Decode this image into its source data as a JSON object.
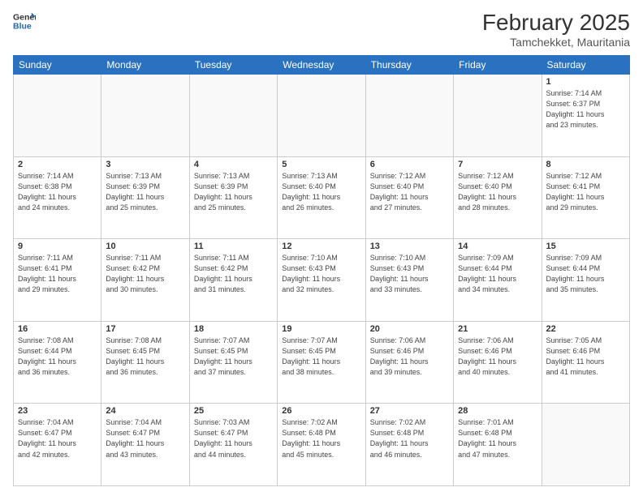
{
  "header": {
    "logo_line1": "General",
    "logo_line2": "Blue",
    "month": "February 2025",
    "location": "Tamchekket, Mauritania"
  },
  "weekdays": [
    "Sunday",
    "Monday",
    "Tuesday",
    "Wednesday",
    "Thursday",
    "Friday",
    "Saturday"
  ],
  "weeks": [
    [
      {
        "day": "",
        "info": ""
      },
      {
        "day": "",
        "info": ""
      },
      {
        "day": "",
        "info": ""
      },
      {
        "day": "",
        "info": ""
      },
      {
        "day": "",
        "info": ""
      },
      {
        "day": "",
        "info": ""
      },
      {
        "day": "1",
        "info": "Sunrise: 7:14 AM\nSunset: 6:37 PM\nDaylight: 11 hours\nand 23 minutes."
      }
    ],
    [
      {
        "day": "2",
        "info": "Sunrise: 7:14 AM\nSunset: 6:38 PM\nDaylight: 11 hours\nand 24 minutes."
      },
      {
        "day": "3",
        "info": "Sunrise: 7:13 AM\nSunset: 6:39 PM\nDaylight: 11 hours\nand 25 minutes."
      },
      {
        "day": "4",
        "info": "Sunrise: 7:13 AM\nSunset: 6:39 PM\nDaylight: 11 hours\nand 25 minutes."
      },
      {
        "day": "5",
        "info": "Sunrise: 7:13 AM\nSunset: 6:40 PM\nDaylight: 11 hours\nand 26 minutes."
      },
      {
        "day": "6",
        "info": "Sunrise: 7:12 AM\nSunset: 6:40 PM\nDaylight: 11 hours\nand 27 minutes."
      },
      {
        "day": "7",
        "info": "Sunrise: 7:12 AM\nSunset: 6:40 PM\nDaylight: 11 hours\nand 28 minutes."
      },
      {
        "day": "8",
        "info": "Sunrise: 7:12 AM\nSunset: 6:41 PM\nDaylight: 11 hours\nand 29 minutes."
      }
    ],
    [
      {
        "day": "9",
        "info": "Sunrise: 7:11 AM\nSunset: 6:41 PM\nDaylight: 11 hours\nand 29 minutes."
      },
      {
        "day": "10",
        "info": "Sunrise: 7:11 AM\nSunset: 6:42 PM\nDaylight: 11 hours\nand 30 minutes."
      },
      {
        "day": "11",
        "info": "Sunrise: 7:11 AM\nSunset: 6:42 PM\nDaylight: 11 hours\nand 31 minutes."
      },
      {
        "day": "12",
        "info": "Sunrise: 7:10 AM\nSunset: 6:43 PM\nDaylight: 11 hours\nand 32 minutes."
      },
      {
        "day": "13",
        "info": "Sunrise: 7:10 AM\nSunset: 6:43 PM\nDaylight: 11 hours\nand 33 minutes."
      },
      {
        "day": "14",
        "info": "Sunrise: 7:09 AM\nSunset: 6:44 PM\nDaylight: 11 hours\nand 34 minutes."
      },
      {
        "day": "15",
        "info": "Sunrise: 7:09 AM\nSunset: 6:44 PM\nDaylight: 11 hours\nand 35 minutes."
      }
    ],
    [
      {
        "day": "16",
        "info": "Sunrise: 7:08 AM\nSunset: 6:44 PM\nDaylight: 11 hours\nand 36 minutes."
      },
      {
        "day": "17",
        "info": "Sunrise: 7:08 AM\nSunset: 6:45 PM\nDaylight: 11 hours\nand 36 minutes."
      },
      {
        "day": "18",
        "info": "Sunrise: 7:07 AM\nSunset: 6:45 PM\nDaylight: 11 hours\nand 37 minutes."
      },
      {
        "day": "19",
        "info": "Sunrise: 7:07 AM\nSunset: 6:45 PM\nDaylight: 11 hours\nand 38 minutes."
      },
      {
        "day": "20",
        "info": "Sunrise: 7:06 AM\nSunset: 6:46 PM\nDaylight: 11 hours\nand 39 minutes."
      },
      {
        "day": "21",
        "info": "Sunrise: 7:06 AM\nSunset: 6:46 PM\nDaylight: 11 hours\nand 40 minutes."
      },
      {
        "day": "22",
        "info": "Sunrise: 7:05 AM\nSunset: 6:46 PM\nDaylight: 11 hours\nand 41 minutes."
      }
    ],
    [
      {
        "day": "23",
        "info": "Sunrise: 7:04 AM\nSunset: 6:47 PM\nDaylight: 11 hours\nand 42 minutes."
      },
      {
        "day": "24",
        "info": "Sunrise: 7:04 AM\nSunset: 6:47 PM\nDaylight: 11 hours\nand 43 minutes."
      },
      {
        "day": "25",
        "info": "Sunrise: 7:03 AM\nSunset: 6:47 PM\nDaylight: 11 hours\nand 44 minutes."
      },
      {
        "day": "26",
        "info": "Sunrise: 7:02 AM\nSunset: 6:48 PM\nDaylight: 11 hours\nand 45 minutes."
      },
      {
        "day": "27",
        "info": "Sunrise: 7:02 AM\nSunset: 6:48 PM\nDaylight: 11 hours\nand 46 minutes."
      },
      {
        "day": "28",
        "info": "Sunrise: 7:01 AM\nSunset: 6:48 PM\nDaylight: 11 hours\nand 47 minutes."
      },
      {
        "day": "",
        "info": ""
      }
    ]
  ]
}
